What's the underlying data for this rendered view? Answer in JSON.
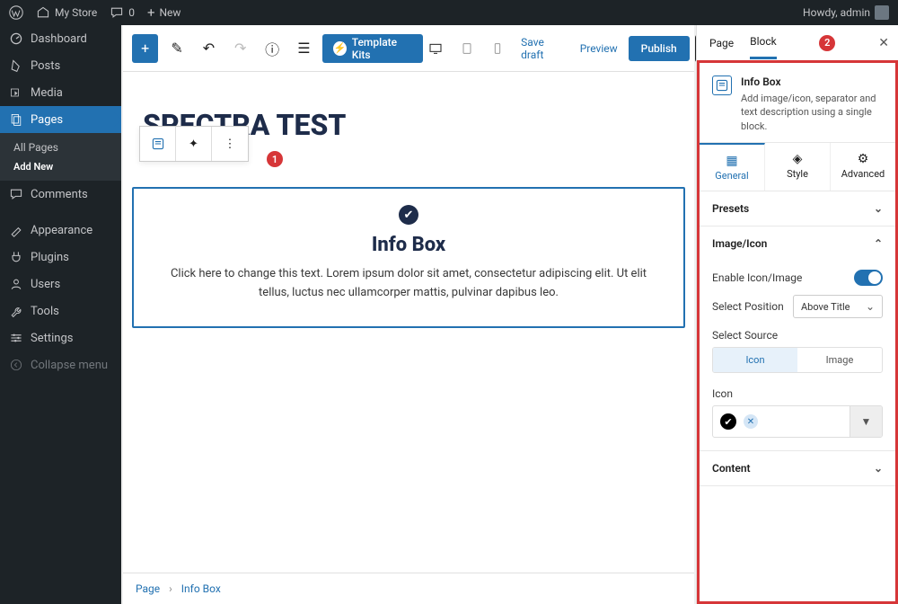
{
  "adminbar": {
    "site": "My Store",
    "comments_count": "0",
    "new_label": "New",
    "howdy": "Howdy, admin"
  },
  "sidebar": {
    "items": [
      {
        "label": "Dashboard",
        "icon": "dashboard"
      },
      {
        "label": "Posts",
        "icon": "pin"
      },
      {
        "label": "Media",
        "icon": "media"
      },
      {
        "label": "Pages",
        "icon": "pages",
        "active": true
      },
      {
        "label": "Comments",
        "icon": "comment"
      },
      {
        "label": "Appearance",
        "icon": "brush"
      },
      {
        "label": "Plugins",
        "icon": "plug"
      },
      {
        "label": "Users",
        "icon": "user"
      },
      {
        "label": "Tools",
        "icon": "wrench"
      },
      {
        "label": "Settings",
        "icon": "sliders"
      }
    ],
    "pages_sub": {
      "all": "All Pages",
      "add": "Add New"
    },
    "collapse": "Collapse menu"
  },
  "topbar": {
    "template_kits": "Template Kits",
    "save_draft": "Save draft",
    "preview": "Preview",
    "publish": "Publish"
  },
  "canvas": {
    "page_title": "SPECTRA TEST",
    "block": {
      "heading": "Info Box",
      "text": "Click here to change this text. Lorem ipsum dolor sit amet, consectetur adipiscing elit. Ut elit tellus, luctus nec ullamcorper mattis, pulvinar dapibus leo."
    },
    "annotation1": "1"
  },
  "breadcrumb": {
    "root": "Page",
    "sep": "›",
    "leaf": "Info Box"
  },
  "panel": {
    "tabs": {
      "page": "Page",
      "block": "Block"
    },
    "annotation2": "2",
    "block_header": {
      "title": "Info Box",
      "desc": "Add image/icon, separator and text description using a single block."
    },
    "subtabs": {
      "general": "General",
      "style": "Style",
      "advanced": "Advanced"
    },
    "sections": {
      "presets": "Presets",
      "image_icon": {
        "title": "Image/Icon",
        "enable_label": "Enable Icon/Image",
        "enable_value": true,
        "position_label": "Select Position",
        "position_value": "Above Title",
        "source_label": "Select Source",
        "source_options": {
          "icon": "Icon",
          "image": "Image"
        },
        "source_value": "Icon",
        "icon_label": "Icon"
      },
      "content": "Content"
    }
  }
}
